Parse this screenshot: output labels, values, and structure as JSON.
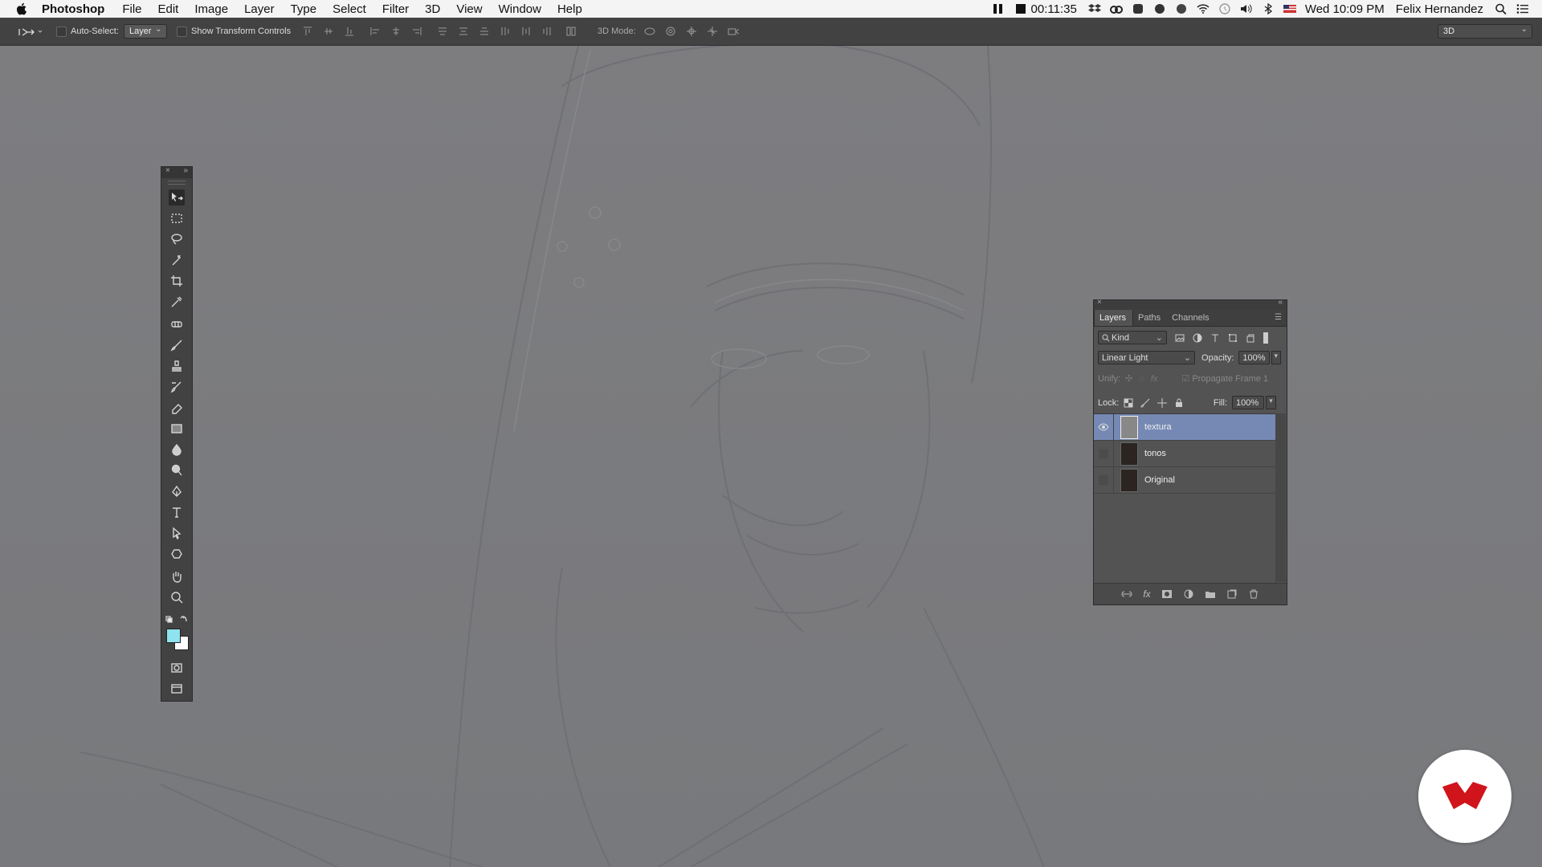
{
  "menubar": {
    "app_name": "Photoshop",
    "menus": [
      "File",
      "Edit",
      "Image",
      "Layer",
      "Type",
      "Select",
      "Filter",
      "3D",
      "View",
      "Window",
      "Help"
    ],
    "timer": "00:11:35",
    "clock": "Wed 10:09 PM",
    "user": "Felix Hernandez"
  },
  "options_bar": {
    "auto_select_label": "Auto-Select:",
    "auto_select_value": "Layer",
    "transform_label": "Show Transform Controls",
    "mode_label": "3D Mode:",
    "workspace": "3D"
  },
  "toolbox": {
    "foreground_color": "#8fe3ee",
    "background_color": "#ffffff"
  },
  "layers_panel": {
    "tabs": [
      "Layers",
      "Paths",
      "Channels"
    ],
    "filter_kind": "Kind",
    "blend_mode": "Linear Light",
    "opacity_label": "Opacity:",
    "opacity_value": "100%",
    "unify_label": "Unify:",
    "propagate_label": "Propagate Frame 1",
    "lock_label": "Lock:",
    "fill_label": "Fill:",
    "fill_value": "100%",
    "layers": [
      {
        "name": "textura",
        "visible": true,
        "selected": true
      },
      {
        "name": "tonos",
        "visible": false,
        "selected": false
      },
      {
        "name": "Original",
        "visible": false,
        "selected": false
      }
    ]
  },
  "colors": {
    "selected_layer": "#7589b4",
    "brand_red": "#d0141b"
  }
}
